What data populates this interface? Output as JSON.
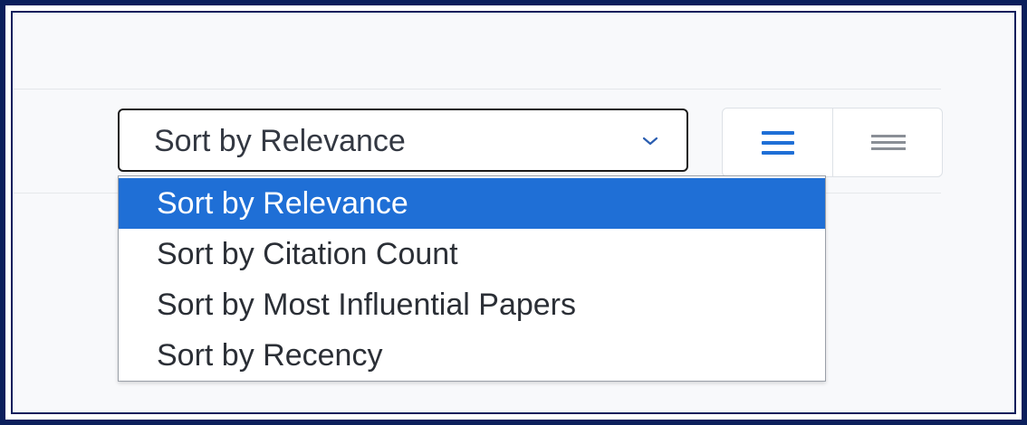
{
  "sort": {
    "selected_label": "Sort by Relevance",
    "options": [
      {
        "label": "Sort by Relevance",
        "selected": true
      },
      {
        "label": "Sort by Citation Count",
        "selected": false
      },
      {
        "label": "Sort by Most Influential Papers",
        "selected": false
      },
      {
        "label": "Sort by Recency",
        "selected": false
      }
    ]
  },
  "view_toggle": {
    "list_icon": "list-view-icon",
    "compact_icon": "compact-view-icon",
    "active": "list"
  },
  "colors": {
    "border_frame": "#0b1f5c",
    "selected_option_bg": "#1f6fd6",
    "active_icon": "#1f6fd6",
    "inactive_icon": "#8a8f96"
  }
}
